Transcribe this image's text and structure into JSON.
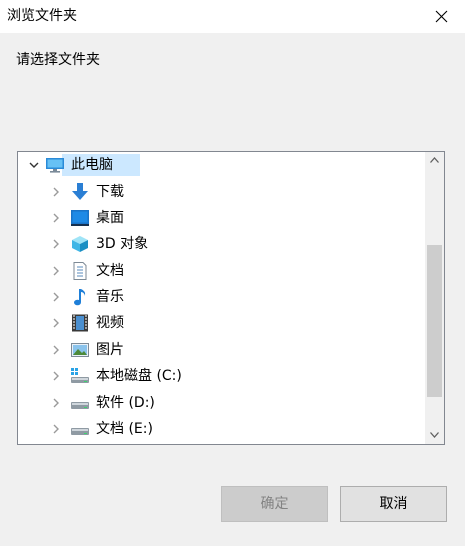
{
  "window": {
    "title": "浏览文件夹"
  },
  "prompt": "请选择文件夹",
  "tree": [
    {
      "label": "此电脑",
      "icon": "computer-icon",
      "expanded": true,
      "selected": true
    },
    {
      "label": "下载",
      "icon": "download-icon"
    },
    {
      "label": "桌面",
      "icon": "desktop-icon"
    },
    {
      "label": "3D 对象",
      "icon": "3d-objects-icon"
    },
    {
      "label": "文档",
      "icon": "documents-icon"
    },
    {
      "label": "音乐",
      "icon": "music-icon"
    },
    {
      "label": "视频",
      "icon": "videos-icon"
    },
    {
      "label": "图片",
      "icon": "pictures-icon"
    },
    {
      "label": "本地磁盘 (C:)",
      "icon": "system-drive-icon"
    },
    {
      "label": "软件 (D:)",
      "icon": "drive-icon"
    },
    {
      "label": "文档 (E:)",
      "icon": "drive-icon"
    }
  ],
  "buttons": {
    "ok": "确定",
    "cancel": "取消",
    "ok_enabled": false
  },
  "colors": {
    "selection": "#cce8ff",
    "accent": "#1e7fd8",
    "border": "#828790"
  }
}
